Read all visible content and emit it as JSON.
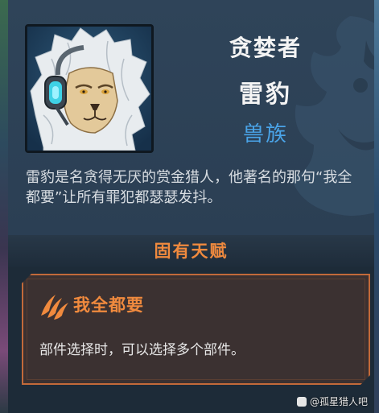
{
  "character": {
    "epithet": "贪婪者",
    "name": "雷豹",
    "race": "兽族",
    "description": "雷豹是名贪得无厌的赏金猎人，他著名的那句“我全都要”让所有罪犯都瑟瑟发抖。"
  },
  "talent_section": {
    "header": "固有天赋",
    "talent_name": "我全都要",
    "talent_desc": "部件选择时，可以选择多个部件。"
  },
  "source_watermark": "@孤星猎人吧",
  "colors": {
    "accent_orange": "#f08a3e",
    "race_blue": "#4aa4e8",
    "card_border": "#c26a3a"
  },
  "icons": {
    "portrait": "lion-bounty-hunter-portrait",
    "emblem": "lion-head-emblem",
    "talent": "claw-icon"
  }
}
